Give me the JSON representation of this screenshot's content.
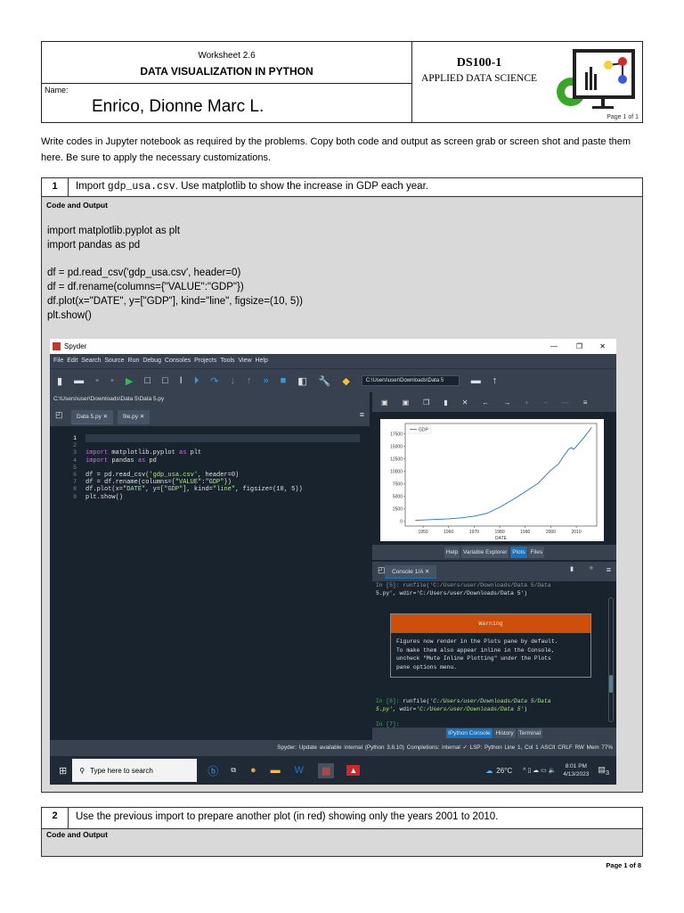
{
  "header": {
    "worksheet": "Worksheet 2.6",
    "title": "DATA VISUALIZATION IN PYTHON",
    "name_label": "Name:",
    "name_value": "Enrico, Dionne Marc L.",
    "course_code": "DS100-1",
    "course_name": "APPLIED DATA SCIENCE",
    "logo_page": "Page 1 of 1"
  },
  "instructions": "Write codes in Jupyter notebook as required by the problems. Copy both code and output as screen grab or screen shot and paste them here. Be sure to apply the necessary customizations.",
  "problem1": {
    "number": "1",
    "q_pre": "Import ",
    "q_file": "gdp_usa.csv",
    "q_post": ". Use matplotlib to show the increase in GDP each year.",
    "code_label": "Code and Output",
    "code": [
      "import matplotlib.pyplot as plt",
      "import pandas as pd",
      "",
      "df = pd.read_csv('gdp_usa.csv', header=0)",
      "df = df.rename(columns={\"VALUE\":\"GDP\"})",
      "df.plot(x=\"DATE\", y=[\"GDP\"], kind=\"line\", figsize=(10, 5))",
      "plt.show()"
    ]
  },
  "spyder": {
    "title": "Spyder",
    "win_min": "—",
    "win_max": "❐",
    "win_close": "✕",
    "menu": [
      "File",
      "Edit",
      "Search",
      "Source",
      "Run",
      "Debug",
      "Consoles",
      "Projects",
      "Tools",
      "View",
      "Help"
    ],
    "wd_path": "C:\\Users\\user\\Downloads\\Data 5",
    "editor_path": "C:\\Users\\user\\Downloads\\Data 5\\Data 5.py",
    "editor_tabs": [
      "Data 5.py ✕",
      "file.py ✕"
    ],
    "line_numbers": [
      "1",
      "2",
      "3",
      "4",
      "5",
      "6",
      "7",
      "8",
      "9"
    ],
    "plot_tabs": [
      "Help",
      "Variable Explorer",
      "Plots",
      "Files"
    ],
    "console_tab": "Console 1/A ✕",
    "console": {
      "prev_line1": "In [5]: runfile('C:/Users/user/Downloads/Data 5/Data",
      "prev_line2": "5.py', wdir='C:/Users/user/Downloads/Data 5')",
      "warning_title": "Warning",
      "warning_body": "Figures now render in the Plots pane by default.\nTo make them also appear inline in the Console,\nuncheck \"Mute Inline Plotting\" under the Plots\npane options menu.",
      "in6_prompt": "In [6]:",
      "in6_cmd": " runfile(",
      "in6_arg1": "'C:/Users/user/Downloads/Data 5/Data",
      "in6_line2a": "5.py'",
      "in6_line2b": ", wdir=",
      "in6_line2c": "'C:/Users/user/Downloads/Data 5'",
      "in6_close": ")",
      "in7_prompt": "In [7]:"
    },
    "console_tabs": [
      "IPython Console",
      "History",
      "Terminal"
    ],
    "status": [
      "Spyder: Update available",
      "internal (Python 3.8.10)",
      "Completions: internal",
      "✓ LSP: Python",
      "Line 1, Col 1",
      "ASCII",
      "CRLF",
      "RW",
      "Mem 77%"
    ],
    "taskbar": {
      "search_placeholder": "Type here to search",
      "weather": "26°C",
      "time": "8:01 PM",
      "date": "4/13/2023",
      "notif_count": "3"
    }
  },
  "chart_data": {
    "type": "line",
    "title": "",
    "xlabel": "DATE",
    "ylabel": "",
    "legend": [
      "GDP"
    ],
    "legend_position": "top-left",
    "x": [
      1947,
      1955,
      1960,
      1965,
      1970,
      1975,
      1980,
      1985,
      1990,
      1995,
      2000,
      2003,
      2005,
      2007,
      2008,
      2009,
      2010,
      2013,
      2016
    ],
    "series": [
      {
        "name": "GDP",
        "color": "#1f77b4",
        "values": [
          243,
          420,
          540,
          740,
          1070,
          1640,
          2860,
          4340,
          5960,
          7640,
          10250,
          11500,
          13040,
          14450,
          14770,
          14420,
          15000,
          16800,
          18800
        ]
      }
    ],
    "xticks": [
      "1950",
      "1960",
      "1970",
      "1980",
      "1990",
      "2000",
      "2010"
    ],
    "yticks": [
      "0",
      "2500",
      "5000",
      "7500",
      "10000",
      "12500",
      "15000",
      "17500"
    ],
    "xlim": [
      1943,
      2018
    ],
    "ylim": [
      -900,
      19600
    ]
  },
  "problem2": {
    "number": "2",
    "question": "Use the previous import to prepare another plot (in red) showing only the years 2001 to 2010.",
    "code_label": "Code and Output"
  },
  "footer": "Page 1 of 8"
}
